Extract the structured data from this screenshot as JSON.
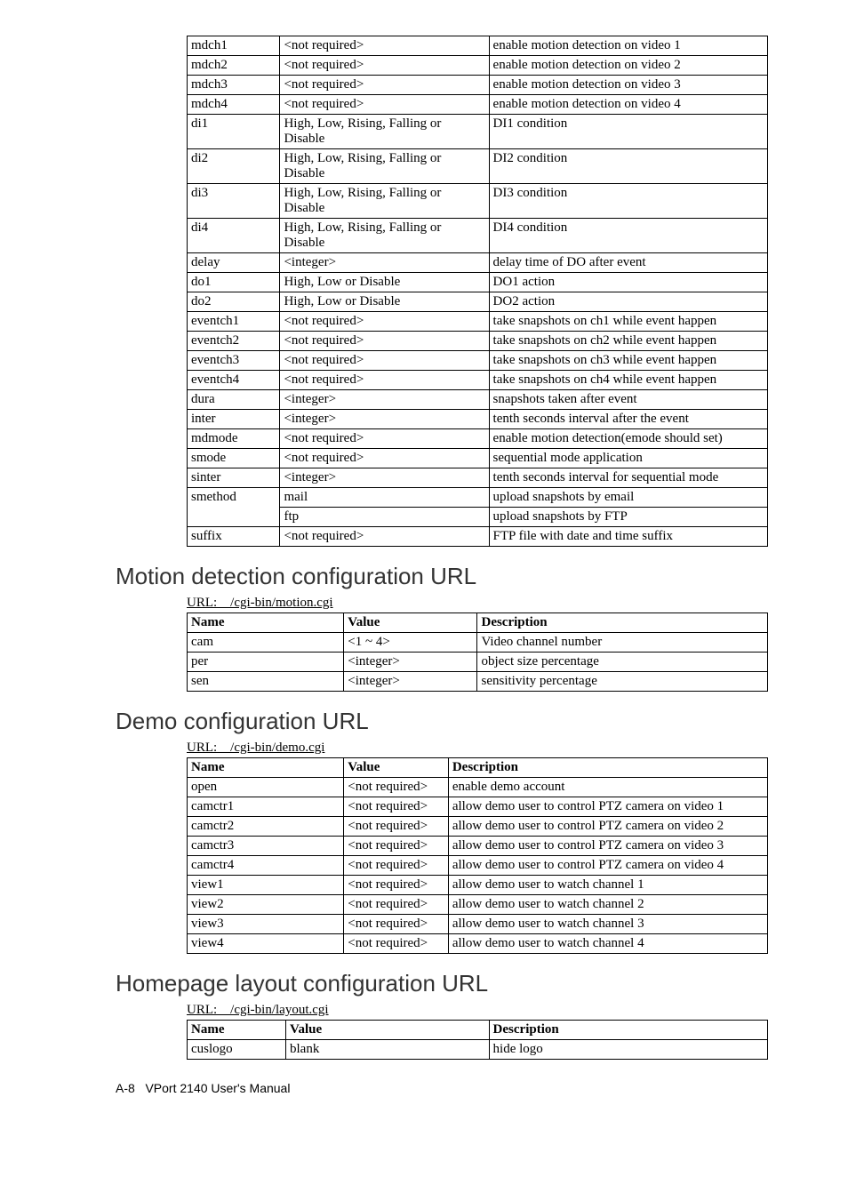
{
  "table1": {
    "rows": [
      [
        "mdch1",
        "<not required>",
        "enable motion detection on video 1"
      ],
      [
        "mdch2",
        "<not required>",
        "enable motion detection on video 2"
      ],
      [
        "mdch3",
        "<not required>",
        "enable motion detection on video 3"
      ],
      [
        "mdch4",
        "<not required>",
        "enable motion detection on video 4"
      ],
      [
        "di1",
        "High, Low, Rising, Falling or Disable",
        "DI1 condition"
      ],
      [
        "di2",
        "High, Low, Rising, Falling or Disable",
        "DI2 condition"
      ],
      [
        "di3",
        "High, Low, Rising, Falling or Disable",
        "DI3 condition"
      ],
      [
        "di4",
        "High, Low, Rising, Falling or Disable",
        "DI4 condition"
      ],
      [
        "delay",
        "<integer>",
        "delay time of DO after event"
      ],
      [
        "do1",
        "High, Low or Disable",
        "DO1 action"
      ],
      [
        "do2",
        "High, Low or Disable",
        "DO2 action"
      ],
      [
        "eventch1",
        "<not required>",
        "take snapshots on ch1 while event happen"
      ],
      [
        "eventch2",
        "<not required>",
        "take snapshots on ch2 while event happen"
      ],
      [
        "eventch3",
        "<not required>",
        "take snapshots on ch3 while event happen"
      ],
      [
        "eventch4",
        "<not required>",
        "take snapshots on ch4 while event happen"
      ],
      [
        "dura",
        "<integer>",
        "snapshots taken after event"
      ],
      [
        "inter",
        "<integer>",
        "tenth seconds interval after the event"
      ],
      [
        "mdmode",
        "<not required>",
        "enable motion detection(emode should set)"
      ],
      [
        "smode",
        "<not required>",
        "sequential mode application"
      ],
      [
        "sinter",
        "<integer>",
        "tenth seconds interval for sequential mode"
      ],
      [
        "smethod",
        "mail",
        "upload snapshots by email"
      ],
      [
        "",
        "ftp",
        "upload snapshots by FTP"
      ],
      [
        "suffix",
        "<not required>",
        "FTP file with date and time suffix"
      ]
    ]
  },
  "section2": {
    "title": "Motion detection configuration URL",
    "url": "URL: /cgi-bin/motion.cgi",
    "headers": [
      "Name",
      "Value",
      "Description"
    ],
    "rows": [
      [
        "cam",
        "<1 ~ 4>",
        "Video channel number"
      ],
      [
        "per",
        "<integer>",
        "object size percentage"
      ],
      [
        "sen",
        "<integer>",
        "sensitivity percentage"
      ]
    ]
  },
  "section3": {
    "title": "Demo configuration URL",
    "url": "URL: /cgi-bin/demo.cgi",
    "headers": [
      "Name",
      "Value",
      "Description"
    ],
    "rows": [
      [
        "open",
        "<not required>",
        "enable demo account"
      ],
      [
        "camctr1",
        "<not required>",
        "allow demo user to control PTZ camera on video 1"
      ],
      [
        "camctr2",
        "<not required>",
        "allow demo user to control PTZ camera on video 2"
      ],
      [
        "camctr3",
        "<not required>",
        "allow demo user to control PTZ camera on video 3"
      ],
      [
        "camctr4",
        "<not required>",
        "allow demo user to control PTZ camera on video 4"
      ],
      [
        "view1",
        "<not required>",
        "allow demo user to watch channel 1"
      ],
      [
        "view2",
        "<not required>",
        "allow demo user to watch channel 2"
      ],
      [
        "view3",
        "<not required>",
        "allow demo user to watch channel 3"
      ],
      [
        "view4",
        "<not required>",
        "allow demo user to watch channel 4"
      ]
    ]
  },
  "section4": {
    "title": "Homepage layout configuration URL",
    "url": "URL: /cgi-bin/layout.cgi",
    "headers": [
      "Name",
      "Value",
      "Description"
    ],
    "rows": [
      [
        "cuslogo",
        "blank",
        "hide logo"
      ]
    ]
  },
  "footer": {
    "page": "A-8",
    "manual": "VPort 2140 User's Manual"
  }
}
